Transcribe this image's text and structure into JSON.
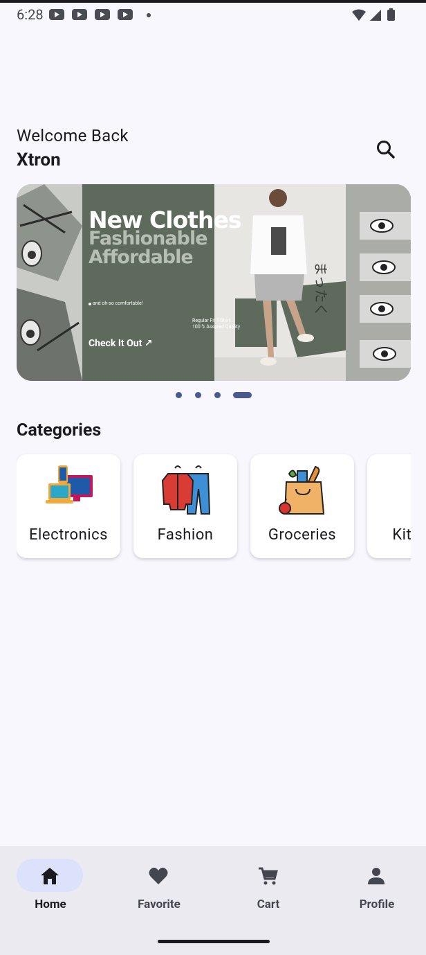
{
  "status_bar": {
    "time": "6:28"
  },
  "header": {
    "greeting": "Welcome Back",
    "username": "Xtron"
  },
  "banner": {
    "headline": "New Clothes",
    "line2": "Fashionable",
    "line3": "Affordable",
    "tagline": "and oh-so comfortable!",
    "cta": "Check It Out ↗",
    "product_line1": "Regular Fit T-Shirt",
    "product_line2": "100 % Assured Quality",
    "side_text": "まったく",
    "slide_count": 4,
    "active_slide": 4
  },
  "categories": {
    "title": "Categories",
    "items": [
      {
        "label": "Electronics",
        "icon": "electronics-icon"
      },
      {
        "label": "Fashion",
        "icon": "clothes-icon"
      },
      {
        "label": "Groceries",
        "icon": "grocery-bag-icon"
      },
      {
        "label": "Kitchen",
        "icon": "kitchen-icon"
      }
    ]
  },
  "bottom_nav": {
    "items": [
      {
        "label": "Home",
        "icon": "home-icon",
        "active": true
      },
      {
        "label": "Favorite",
        "icon": "heart-icon",
        "active": false
      },
      {
        "label": "Cart",
        "icon": "cart-icon",
        "active": false
      },
      {
        "label": "Profile",
        "icon": "person-icon",
        "active": false
      }
    ]
  },
  "colors": {
    "background": "#f8f7fd",
    "accent": "#485a8f",
    "nav_active_pill": "#dce2fb",
    "banner_green": "#5d6a5c"
  }
}
